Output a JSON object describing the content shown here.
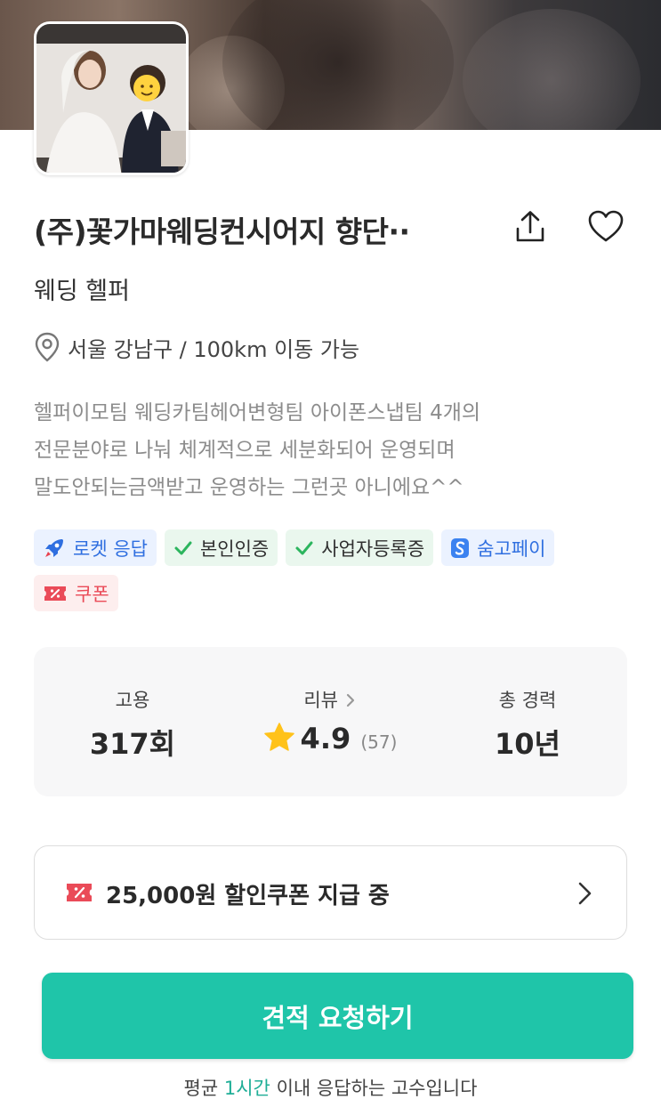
{
  "profile": {
    "title": "(주)꽃가마웨딩컨시어지 향단··",
    "category": "웨딩 헬퍼",
    "location": "서울 강남구 / 100km 이동 가능",
    "intro_lines": [
      "헬퍼이모팀 웨딩카팀헤어변형팀 아이폰스냅팀 4개의",
      "전문분야로 나눠 체계적으로 세분화되어 운영되며",
      "말도안되는금액받고 운영하는 그런곳 아니에요^^"
    ]
  },
  "badges": {
    "rocket": "로켓 응답",
    "identity": "본인인증",
    "business": "사업자등록증",
    "pay": "숨고페이",
    "coupon": "쿠폰"
  },
  "stats": {
    "hires_label": "고용",
    "hires_value": "317회",
    "review_label": "리뷰",
    "review_score": "4.9",
    "review_count": "(57)",
    "career_label": "총 경력",
    "career_value": "10년"
  },
  "coupon_banner": "25,000원 할인쿠폰 지급 중",
  "cta_label": "견적 요청하기",
  "response": {
    "prefix": "평균 ",
    "highlight": "1시간",
    "suffix": " 이내 응답하는 고수입니다"
  },
  "colors": {
    "accent": "#1fc5a9",
    "badge_blue": "#2f6fe0",
    "badge_red": "#ea4b58",
    "check_green": "#2cb55e",
    "star": "#ffc21a"
  },
  "icons": [
    "share-icon",
    "heart-icon",
    "location-pin-icon",
    "rocket-icon",
    "check-icon",
    "soomgo-pay-icon",
    "coupon-icon",
    "star-icon",
    "chevron-right-icon"
  ]
}
